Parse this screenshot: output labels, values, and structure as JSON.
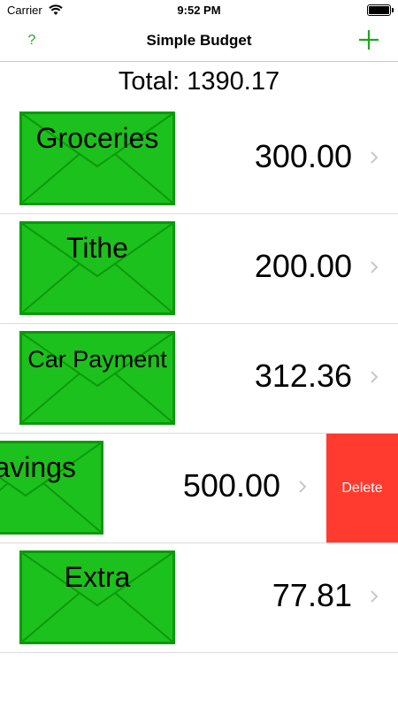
{
  "status_bar": {
    "carrier": "Carrier",
    "time": "9:52 PM"
  },
  "nav": {
    "help_label": "?",
    "title": "Simple Budget",
    "add_icon": "plus-icon"
  },
  "total_text": "Total: 1390.17",
  "envelopes": [
    {
      "name": "Groceries",
      "amount": "300.00"
    },
    {
      "name": "Tithe",
      "amount": "200.00"
    },
    {
      "name": "Car Payment",
      "amount": "312.36"
    },
    {
      "name": "Savings",
      "amount": "500.00",
      "swiped": true,
      "delete_label": "Delete"
    },
    {
      "name": "Extra",
      "amount": "77.81"
    }
  ],
  "colors": {
    "accent": "#1fa61f",
    "envelope_fill": "#1dc11d",
    "envelope_stroke": "#0a9a0a",
    "delete": "#ff3b30"
  }
}
